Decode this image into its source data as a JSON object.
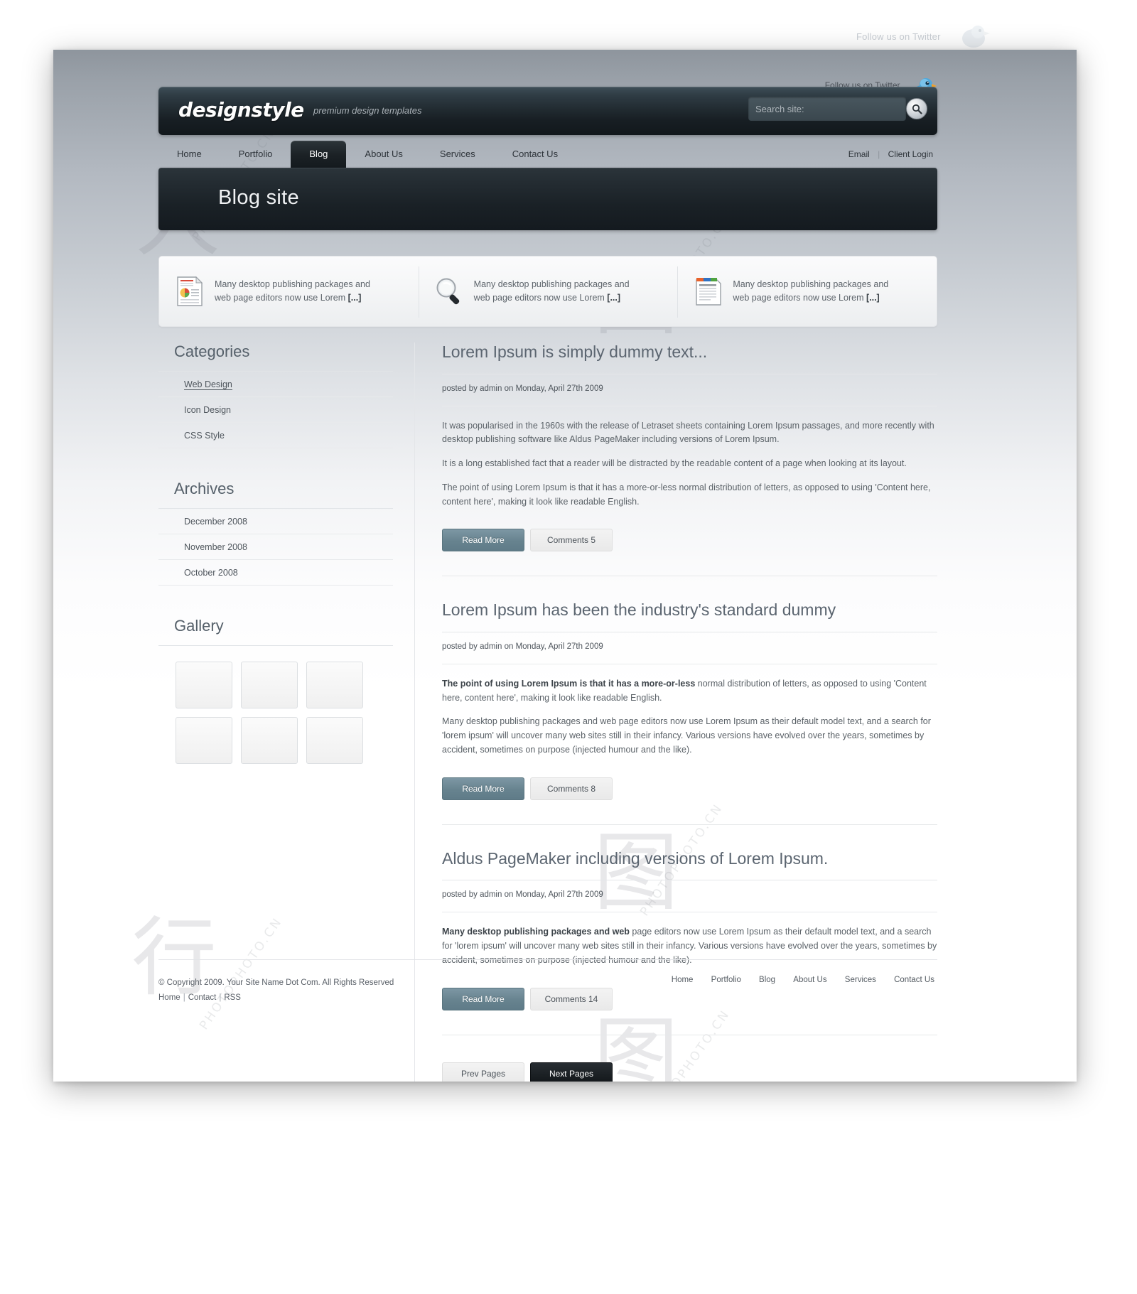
{
  "watermark": {
    "top_text": "Follow us on Twitter",
    "tiles": [
      "PHOTOPHOTO.CN",
      "PHOTOPHOTO.CN",
      "PHOTOPHOTO.CN",
      "PHOTOPHOTO.CN",
      "PHOTOPHOTO.CN"
    ]
  },
  "colors": {
    "accent_button": "#67838f",
    "header_dark": "#1a2126",
    "banner_dark": "#1a2126",
    "page_bg": "#ffffff",
    "heading_text": "#5b6570",
    "body_text": "#5b6268"
  },
  "topbar": {
    "twitter_label": "Follow us on Twitter",
    "twitter_icon": "twitter-bird-icon"
  },
  "header": {
    "logo": "designstyle",
    "tagline": "premium design templates",
    "search": {
      "placeholder": "Search site:",
      "value": "",
      "button_icon": "search-icon"
    }
  },
  "nav": {
    "items": [
      {
        "label": "Home",
        "active": false
      },
      {
        "label": "Portfolio",
        "active": false
      },
      {
        "label": "Blog",
        "active": true
      },
      {
        "label": "About Us",
        "active": false
      },
      {
        "label": "Services",
        "active": false
      },
      {
        "label": "Contact Us",
        "active": false
      }
    ],
    "right": {
      "email": "Email",
      "separator": "|",
      "client_login": "Client Login"
    }
  },
  "banner": {
    "title": "Blog site"
  },
  "features": [
    {
      "icon": "document-chart-icon",
      "line1": "Many desktop publishing packages and",
      "line2_pre": "web page editors now use Lorem ",
      "line2_link": "[...]"
    },
    {
      "icon": "magnifier-icon",
      "line1": "Many desktop publishing packages and",
      "line2_pre": "web page editors now use Lorem ",
      "line2_link": "[...]"
    },
    {
      "icon": "browser-window-icon",
      "line1": "Many desktop publishing packages and",
      "line2_pre": "web page editors now use Lorem ",
      "line2_link": "[...]"
    }
  ],
  "sidebar": {
    "categories": {
      "heading": "Categories",
      "items": [
        {
          "label": "Web Design",
          "selected": true
        },
        {
          "label": "Icon  Design",
          "selected": false
        },
        {
          "label": "CSS Style",
          "selected": false
        }
      ]
    },
    "archives": {
      "heading": "Archives",
      "items": [
        {
          "label": "December 2008"
        },
        {
          "label": "November 2008"
        },
        {
          "label": "October 2008"
        }
      ]
    },
    "gallery": {
      "heading": "Gallery",
      "thumb_count": 6
    }
  },
  "posts": [
    {
      "title": "Lorem Ipsum is simply dummy text...",
      "meta": "posted by admin on Monday, April 27th 2009",
      "paragraphs": [
        {
          "bold": "",
          "text": "It was popularised in the 1960s with the release of Letraset sheets containing Lorem Ipsum passages, and more recently with desktop publishing software like Aldus PageMaker including versions of Lorem Ipsum."
        },
        {
          "bold": "",
          "text": "It is a long established fact that a reader will be distracted by the readable content of a page when looking at its layout."
        },
        {
          "bold": "",
          "text": "The point of using Lorem Ipsum is that it has a more-or-less normal distribution of letters, as opposed to using 'Content here, content here', making it look like readable English."
        }
      ],
      "read_more": "Read More",
      "comments": "Comments 5"
    },
    {
      "title": "Lorem Ipsum has been the industry's standard dummy",
      "meta": "posted by admin on Monday, April 27th 2009",
      "paragraphs": [
        {
          "bold": "The point of using Lorem Ipsum is that it has a more-or-less",
          "text": " normal distribution of letters, as opposed to using 'Content here, content here', making it look like readable English."
        },
        {
          "bold": "",
          "text": "Many desktop publishing packages and web page editors now use Lorem Ipsum as their default model text, and a search for 'lorem ipsum' will uncover many web sites still in their infancy. Various versions have evolved over the years, sometimes by accident, sometimes on purpose (injected humour and the like)."
        }
      ],
      "read_more": "Read More",
      "comments": "Comments 8"
    },
    {
      "title": "Aldus PageMaker including versions of Lorem Ipsum.",
      "meta": "posted by admin on Monday, April 27th 2009",
      "paragraphs": [
        {
          "bold": "Many desktop publishing packages and web",
          "text": " page editors now use Lorem Ipsum as their default model text, and a search for 'lorem ipsum' will uncover many web sites still in their infancy. Various versions have evolved over the years, sometimes by accident, sometimes on purpose (injected humour and the like)."
        }
      ],
      "read_more": "Read More",
      "comments": "Comments 14"
    }
  ],
  "pager": {
    "prev": "Prev Pages",
    "next": "Next Pages"
  },
  "footer": {
    "copyright": "© Copyright 2009. Your Site Name Dot Com. All Rights Reserved",
    "links": [
      "Home",
      "Contact",
      "RSS"
    ],
    "separator": "|",
    "nav": [
      "Home",
      "Portfolio",
      "Blog",
      "About Us",
      "Services",
      "Contact Us"
    ]
  }
}
